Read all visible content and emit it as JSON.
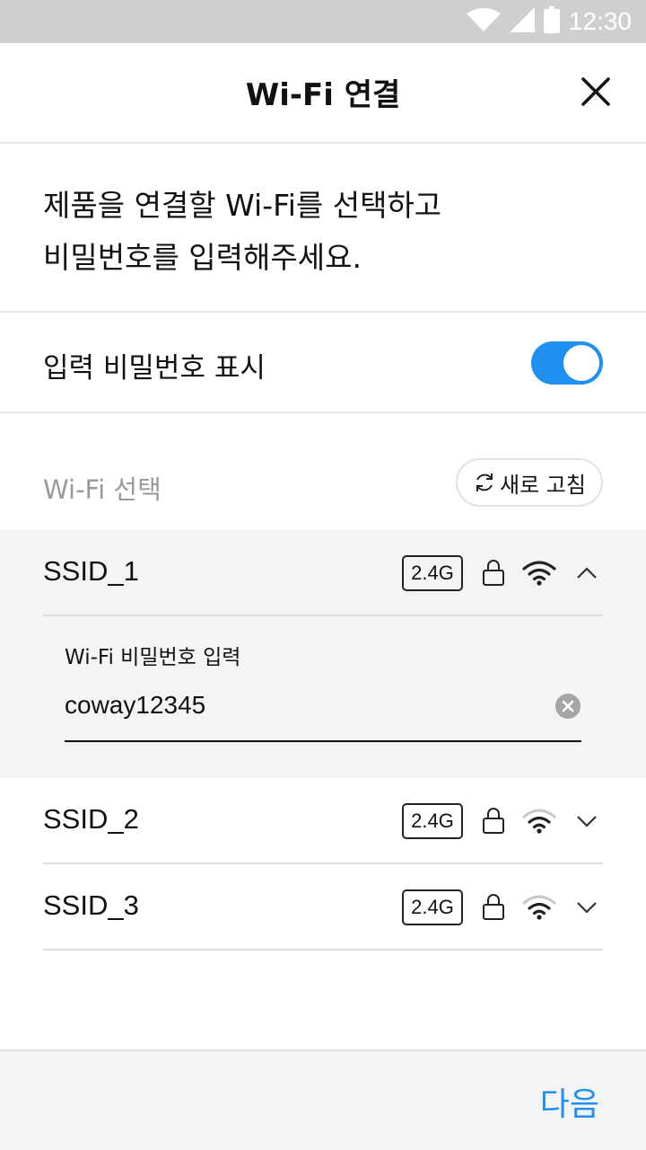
{
  "status_bar": {
    "time": "12:30"
  },
  "header": {
    "title": "Wi-Fi 연결"
  },
  "instruction": {
    "line1": "제품을 연결할 Wi-Fi를 선택하고",
    "line2": "비밀번호를 입력해주세요."
  },
  "toggle": {
    "label": "입력 비밀번호 표시",
    "on": true
  },
  "wifi_section": {
    "label": "Wi-Fi 선택",
    "refresh_label": "새로 고침"
  },
  "networks": [
    {
      "ssid": "SSID_1",
      "band": "2.4G",
      "locked": true,
      "expanded": true
    },
    {
      "ssid": "SSID_2",
      "band": "2.4G",
      "locked": true,
      "expanded": false
    },
    {
      "ssid": "SSID_3",
      "band": "2.4G",
      "locked": true,
      "expanded": false
    }
  ],
  "password": {
    "label": "Wi-Fi 비밀번호 입력",
    "value": "coway12345"
  },
  "footer": {
    "next_label": "다음"
  },
  "colors": {
    "accent": "#1f8ff0",
    "expanded_bg": "#f3f4f6",
    "status_bar": "#cfcfcf"
  }
}
